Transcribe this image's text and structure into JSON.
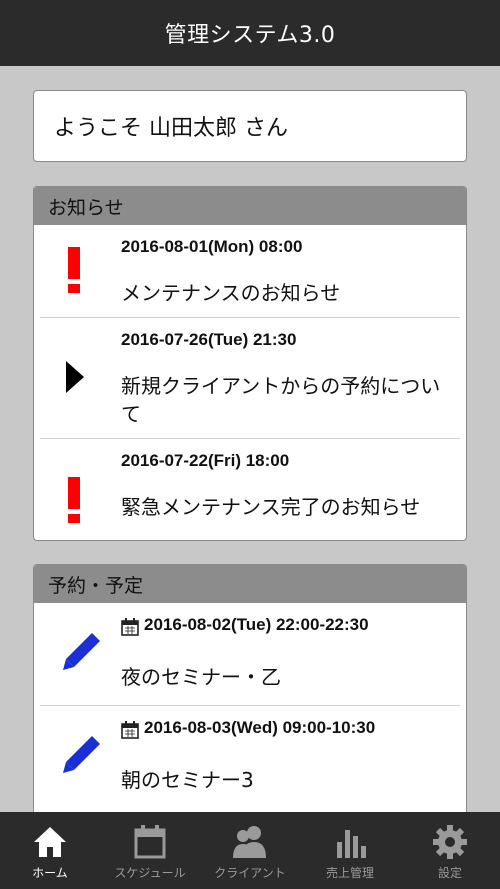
{
  "header": {
    "title": "管理システム3.0"
  },
  "welcome": {
    "text": "ようこそ 山田太郎 さん"
  },
  "notices": {
    "title": "お知らせ",
    "items": [
      {
        "date": "2016-08-01(Mon) 08:00",
        "title": "メンテナンスのお知らせ",
        "icon": "exclamation-icon"
      },
      {
        "date": "2016-07-26(Tue) 21:30",
        "title": "新規クライアントからの予約について",
        "icon": "arrow-right-icon"
      },
      {
        "date": "2016-07-22(Fri) 18:00",
        "title": "緊急メンテナンス完了のお知らせ",
        "icon": "exclamation-icon"
      }
    ]
  },
  "schedule": {
    "title": "予約・予定",
    "items": [
      {
        "date": "2016-08-02(Tue) 22:00-22:30",
        "title": "夜のセミナー・乙",
        "icon": "pencil-icon"
      },
      {
        "date": "2016-08-03(Wed) 09:00-10:30",
        "title": "朝のセミナー3",
        "icon": "pencil-icon"
      }
    ]
  },
  "nav": {
    "items": [
      {
        "label": "ホーム",
        "icon": "home-icon",
        "active": true
      },
      {
        "label": "スケジュール",
        "icon": "calendar-icon",
        "active": false
      },
      {
        "label": "クライアント",
        "icon": "users-icon",
        "active": false
      },
      {
        "label": "売上管理",
        "icon": "bar-chart-icon",
        "active": false
      },
      {
        "label": "設定",
        "icon": "gear-icon",
        "active": false
      }
    ]
  },
  "colors": {
    "alert": "#ff0000",
    "pencil": "#1a2fd6",
    "header_bg": "#2b2b2b"
  }
}
